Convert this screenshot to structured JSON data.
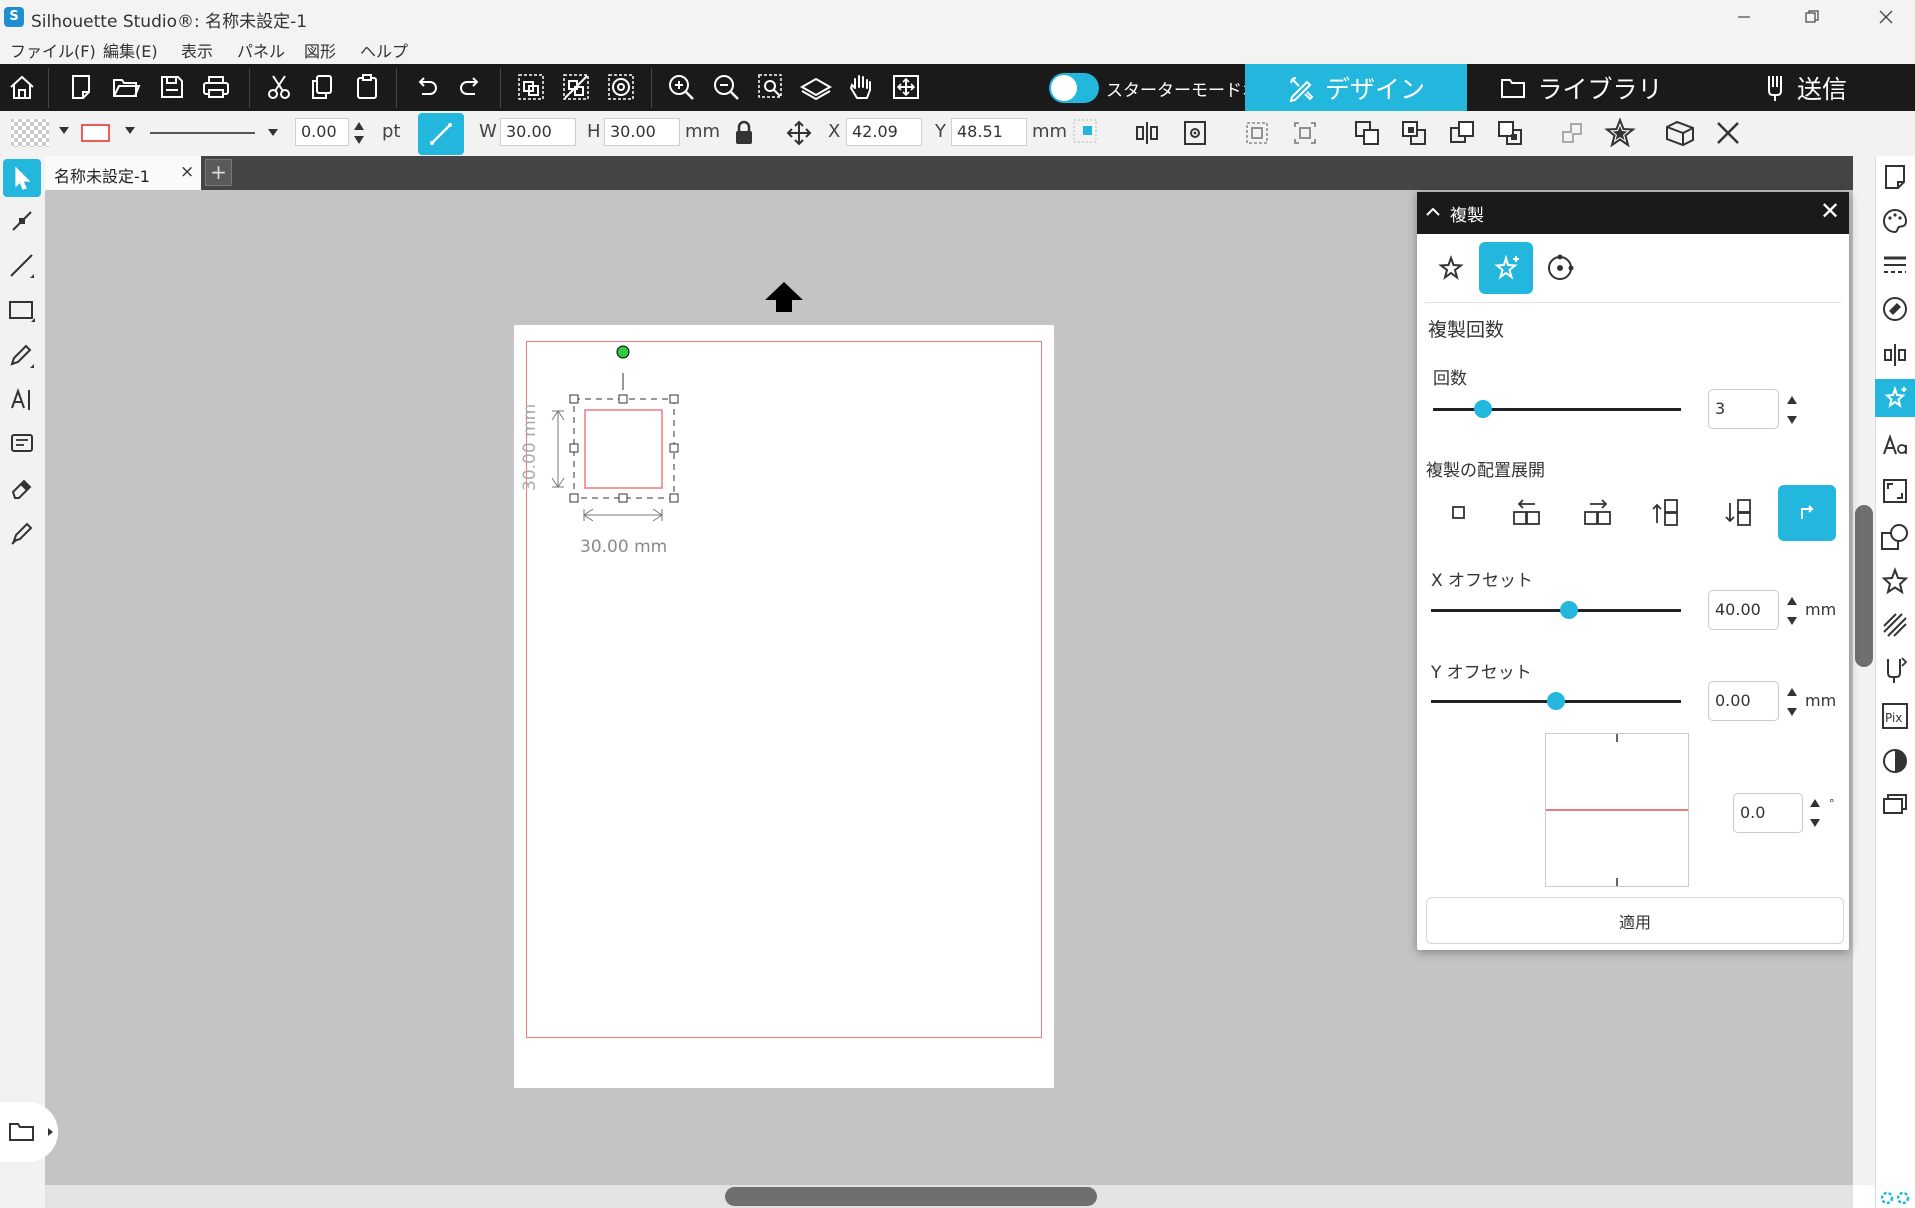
{
  "app": {
    "title": "Silhouette Studio®: 名称未設定-1",
    "logo_letter": "S"
  },
  "menu": [
    "ファイル(F)",
    "編集(E)",
    "表示",
    "パネル",
    "図形",
    "ヘルプ"
  ],
  "toolbar": {
    "mode_label": "スターターモードオフ",
    "mode_on": false,
    "tabs": [
      {
        "label": "デザイン",
        "icon": "design-icon",
        "active": true
      },
      {
        "label": "ライブラリ",
        "icon": "folder-icon",
        "active": false
      },
      {
        "label": "送信",
        "icon": "send-icon",
        "active": false
      }
    ]
  },
  "properties": {
    "line_width": "0.00",
    "line_unit": "pt",
    "w_label": "W",
    "width": "30.00",
    "h_label": "H",
    "height": "30.00",
    "size_unit": "mm",
    "x_label": "X",
    "x": "42.09",
    "y_label": "Y",
    "y": "48.51",
    "pos_unit": "mm"
  },
  "document": {
    "tab_name": "名称未設定-1",
    "close": "×",
    "add": "+"
  },
  "canvas": {
    "dim_width": "30.00 mm",
    "dim_height": "30.00 mm"
  },
  "replicate_panel": {
    "title": "複製",
    "close": "✕",
    "section_title": "複製回数",
    "count_label": "回数",
    "count": "3",
    "count_fraction": 0.2,
    "layout_label": "複製の配置展開",
    "x_offset_label": "X オフセット",
    "x_offset": "40.00",
    "x_offset_fraction": 0.55,
    "y_offset_label": "Y オフセット",
    "y_offset": "0.00",
    "y_offset_fraction": 0.5,
    "offset_unit": "mm",
    "angle": "0.0",
    "angle_unit": "°",
    "apply_label": "適用"
  },
  "colors": {
    "accent": "#24b7de",
    "toolbar_bg": "#1a1a1a",
    "canvas_bg": "#c4c4c4",
    "cut_line": "#f07a7a"
  }
}
